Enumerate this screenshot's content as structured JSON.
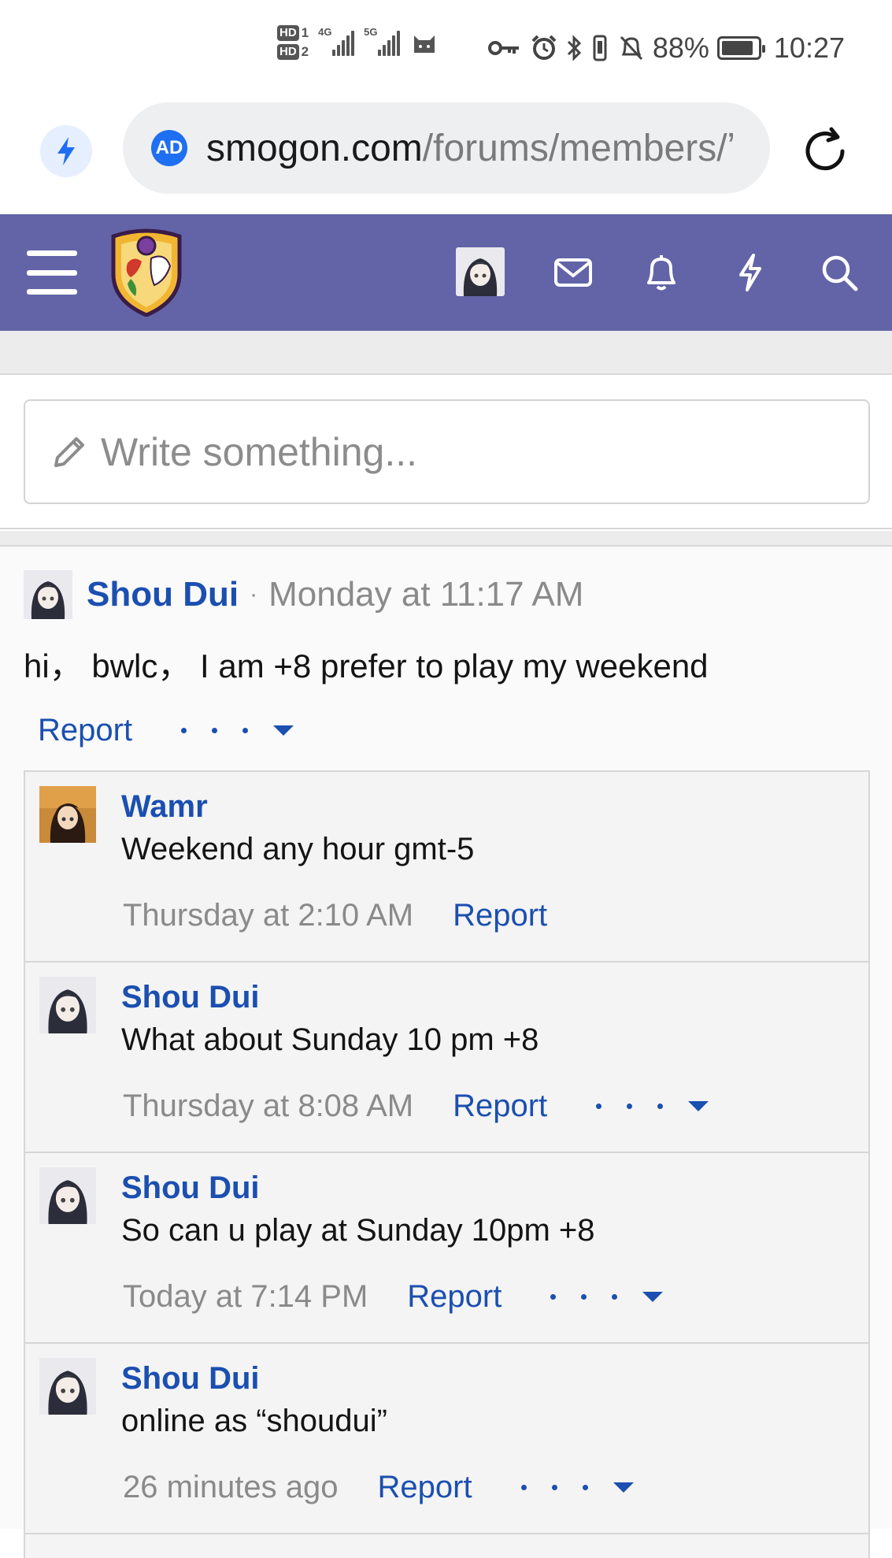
{
  "status_bar": {
    "hd1": "HD",
    "hd1_num": "1",
    "hd2": "HD",
    "hd2_num": "2",
    "net1": "4G",
    "net2": "5G",
    "battery_percent": "88%",
    "battery_level": 0.88,
    "time": "10:27",
    "icons": [
      "cat-icon",
      "key-icon",
      "alarm-icon",
      "bluetooth-icon",
      "vibrate-icon",
      "bell-off-icon"
    ]
  },
  "browser": {
    "ad_badge": "AD",
    "url_domain": "smogon.com",
    "url_path": "/forums/members/ʼ",
    "icons": [
      "bolt-icon",
      "reload-icon"
    ]
  },
  "header": {
    "icons": [
      "menu-icon",
      "mail-icon",
      "bell-icon",
      "bolt-icon",
      "search-icon"
    ],
    "color": "#6264a7"
  },
  "compose": {
    "placeholder": "Write something..."
  },
  "post": {
    "author": "Shou Dui",
    "separator": "·",
    "time": "Monday at 11:17 AM",
    "body": "hi， bwlc， I am +8 prefer to play my weekend",
    "report_label": "Report"
  },
  "comments": [
    {
      "author": "Wamr",
      "text": "Weekend any hour gmt-5",
      "time": "Thursday at 2:10 AM",
      "report_label": "Report"
    },
    {
      "author": "Shou Dui",
      "text": "What about Sunday 10 pm +8",
      "time": "Thursday at 8:08 AM",
      "report_label": "Report"
    },
    {
      "author": "Shou Dui",
      "text": "So can u play at Sunday 10pm +8",
      "time": "Today at 7:14 PM",
      "report_label": "Report"
    },
    {
      "author": "Shou Dui",
      "text": "online as “shoudui”",
      "time": "26 minutes ago",
      "report_label": "Report"
    }
  ],
  "colors": {
    "link": "#1b4fb0",
    "header": "#6264a7",
    "muted": "#8a8a8a"
  }
}
